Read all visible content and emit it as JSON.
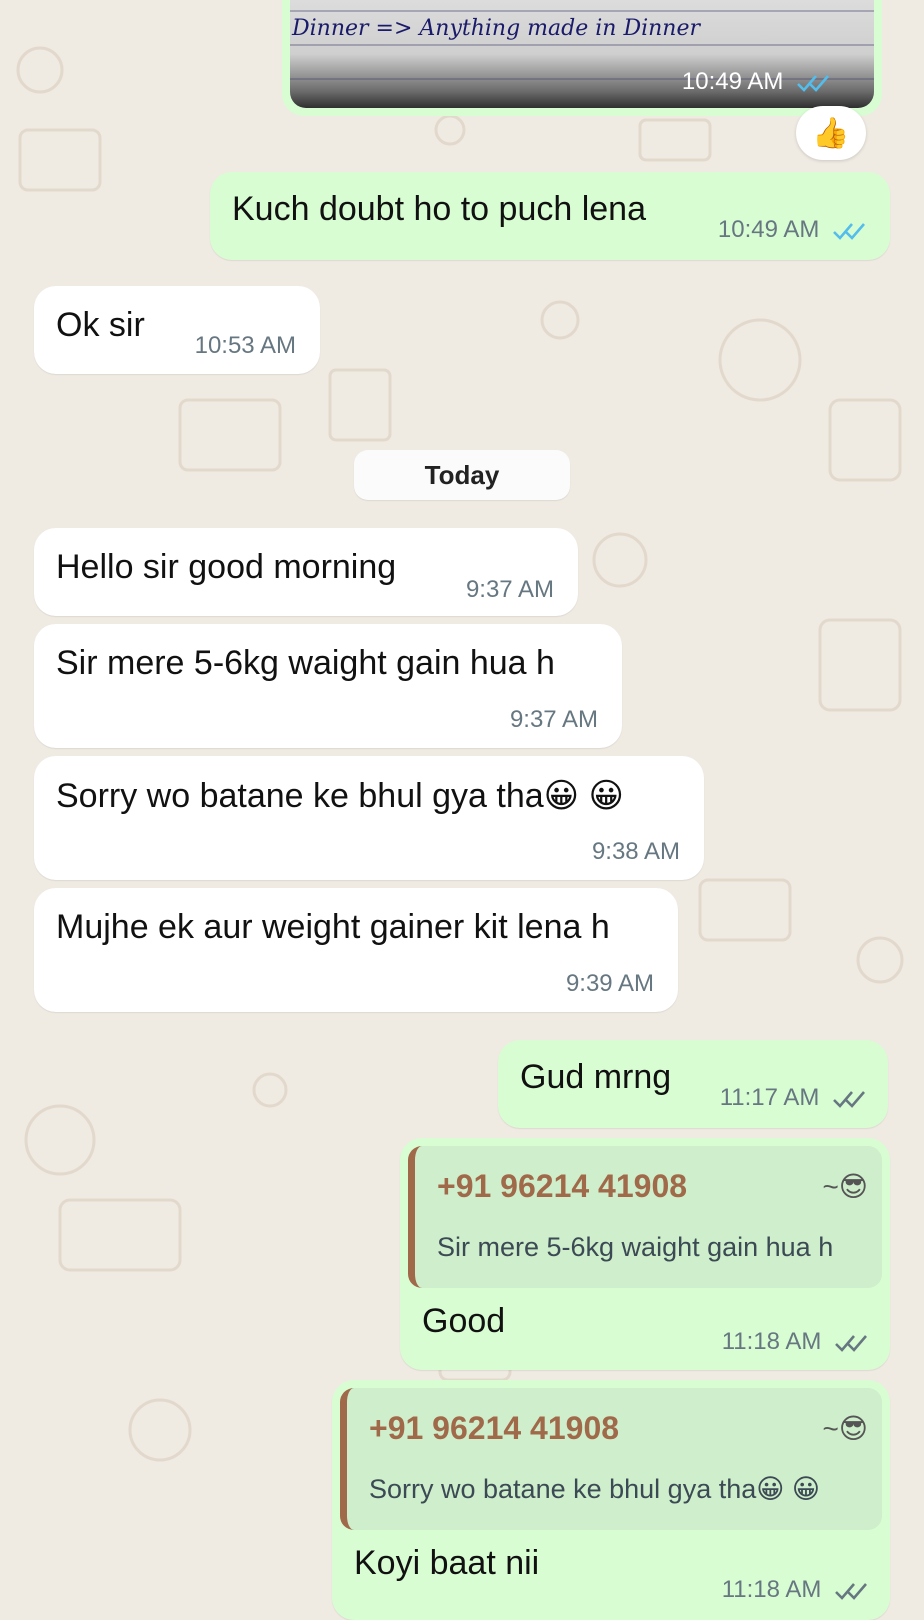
{
  "colors": {
    "incoming_bubble": "#ffffff",
    "outgoing_bubble": "#d9fdd3",
    "read_ticks": "#53bdeb",
    "delivered_ticks": "#667781",
    "quote_accent": "#a0694a"
  },
  "photo_message": {
    "handwriting": "Dinner => Anything made in Dinner",
    "time": "10:49 AM",
    "status_icon": "double-check-read-icon"
  },
  "reaction": {
    "emoji": "👍"
  },
  "messages": [
    {
      "text": "Kuch doubt ho to puch lena",
      "time": "10:49 AM",
      "status_icon": "double-check-read-icon"
    },
    {
      "text": "Ok sir",
      "time": "10:53 AM"
    },
    {
      "text": "Hello sir good morning",
      "time": "9:37 AM"
    },
    {
      "text": "Sir mere 5-6kg waight gain hua h",
      "time": "9:37 AM"
    },
    {
      "text": "Sorry wo batane ke bhul gya tha😀 😀",
      "time": "9:38 AM"
    },
    {
      "text": "Mujhe ek aur weight gainer kit lena h",
      "time": "9:39 AM"
    },
    {
      "text": "Gud mrng",
      "time": "11:17 AM",
      "status_icon": "double-check-delivered-icon"
    },
    {
      "quote": {
        "sender": "+91 96214 41908",
        "sender_emoji": "~😎",
        "text": "Sir mere 5-6kg waight gain hua h"
      },
      "text": "Good",
      "time": "11:18 AM",
      "status_icon": "double-check-delivered-icon"
    },
    {
      "quote": {
        "sender": "+91 96214 41908",
        "sender_emoji": "~😎",
        "text": "Sorry wo batane ke bhul gya tha😀 😀"
      },
      "text": "Koyi baat nii",
      "time": "11:18 AM",
      "status_icon": "double-check-delivered-icon"
    }
  ],
  "date_separator": "Today"
}
